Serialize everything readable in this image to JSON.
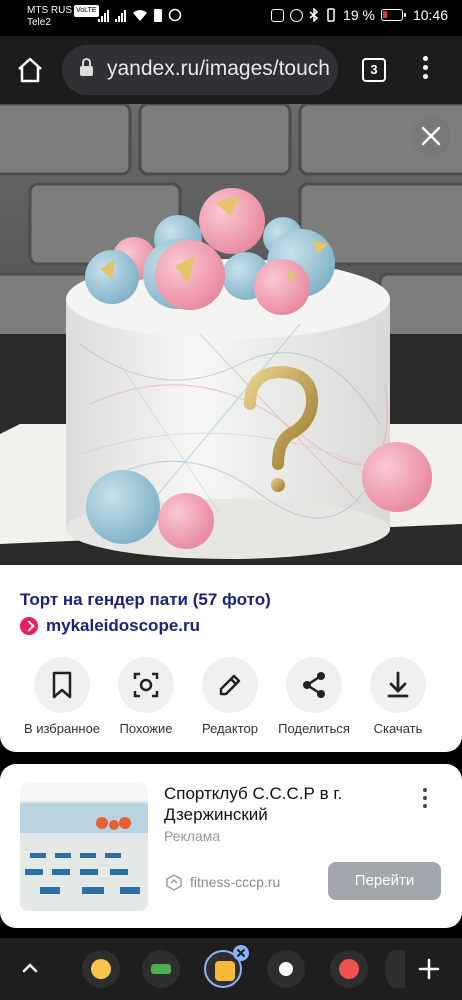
{
  "status_bar": {
    "carrier_1": "MTS RUS",
    "carrier_1_badge": "VoLTE",
    "carrier_2": "Tele2",
    "battery_percent": "19 %",
    "time": "10:46"
  },
  "browser": {
    "url": "yandex.ru/images/touch",
    "tab_count": "3"
  },
  "image_info": {
    "title": "Торт на гендер пати (57 фото)",
    "source": "mykaleidoscope.ru"
  },
  "actions": [
    {
      "label": "В избранное",
      "icon": "bookmark-icon"
    },
    {
      "label": "Похожие",
      "icon": "lens-icon"
    },
    {
      "label": "Редактор",
      "icon": "pencil-icon"
    },
    {
      "label": "Поделиться",
      "icon": "share-icon"
    },
    {
      "label": "Скачать",
      "icon": "download-icon"
    }
  ],
  "ad": {
    "title": "Спортклуб С.С.С.Р в г. Дзержинский",
    "label": "Реклама",
    "domain": "fitness-cccp.ru",
    "button": "Перейти"
  },
  "colors": {
    "link_blue": "#1a237e",
    "button_gray": "#a3a6ad",
    "battery_red": "#e53935"
  }
}
